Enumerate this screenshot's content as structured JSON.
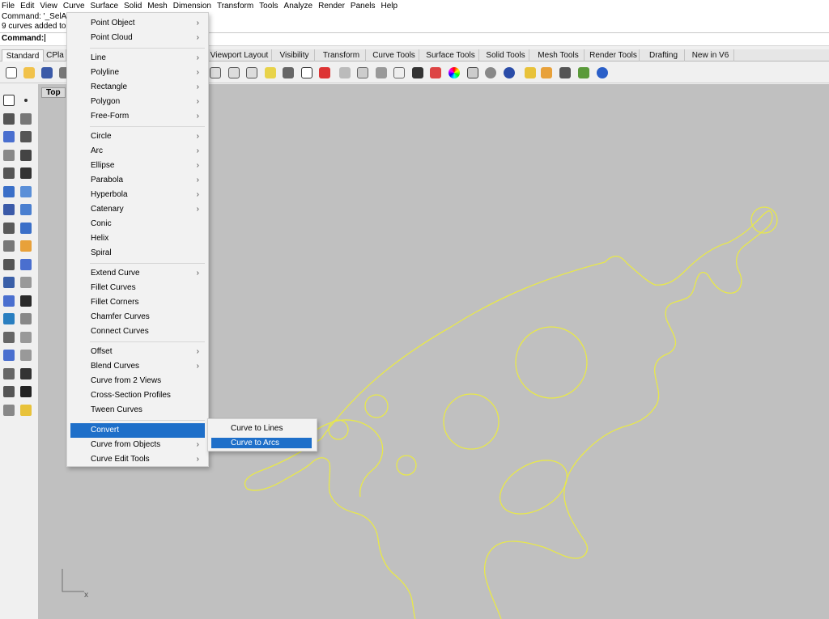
{
  "menubar": {
    "items": [
      "File",
      "Edit",
      "View",
      "Curve",
      "Surface",
      "Solid",
      "Mesh",
      "Dimension",
      "Transform",
      "Tools",
      "Analyze",
      "Render",
      "Panels",
      "Help"
    ]
  },
  "command": {
    "history": [
      "Command: '_SelAll",
      "9 curves added to"
    ],
    "prompt": "Command:"
  },
  "tabs": {
    "items": [
      "Standard",
      "CPla",
      "Viewport Layout",
      "Visibility",
      "Transform",
      "Curve Tools",
      "Surface Tools",
      "Solid Tools",
      "Mesh Tools",
      "Render Tools",
      "Drafting",
      "New in V6"
    ]
  },
  "viewport": {
    "name": "Top",
    "axis_label": "x",
    "curve_color": "#e8e84a"
  },
  "curve_menu": {
    "groups": [
      [
        {
          "label": "Point Object",
          "submenu": true
        },
        {
          "label": "Point Cloud",
          "submenu": true
        }
      ],
      [
        {
          "label": "Line",
          "submenu": true
        },
        {
          "label": "Polyline",
          "submenu": true
        },
        {
          "label": "Rectangle",
          "submenu": true
        },
        {
          "label": "Polygon",
          "submenu": true
        },
        {
          "label": "Free-Form",
          "submenu": true
        }
      ],
      [
        {
          "label": "Circle",
          "submenu": true
        },
        {
          "label": "Arc",
          "submenu": true
        },
        {
          "label": "Ellipse",
          "submenu": true
        },
        {
          "label": "Parabola",
          "submenu": true
        },
        {
          "label": "Hyperbola",
          "submenu": true
        },
        {
          "label": "Catenary",
          "submenu": true
        },
        {
          "label": "Conic",
          "submenu": false
        },
        {
          "label": "Helix",
          "submenu": false
        },
        {
          "label": "Spiral",
          "submenu": false
        }
      ],
      [
        {
          "label": "Extend Curve",
          "submenu": true
        },
        {
          "label": "Fillet Curves",
          "submenu": false
        },
        {
          "label": "Fillet Corners",
          "submenu": false
        },
        {
          "label": "Chamfer Curves",
          "submenu": false
        },
        {
          "label": "Connect Curves",
          "submenu": false
        }
      ],
      [
        {
          "label": "Offset",
          "submenu": true
        },
        {
          "label": "Blend Curves",
          "submenu": true
        },
        {
          "label": "Curve from 2 Views",
          "submenu": false
        },
        {
          "label": "Cross-Section Profiles",
          "submenu": false
        },
        {
          "label": "Tween Curves",
          "submenu": false
        }
      ],
      [
        {
          "label": "Convert",
          "submenu": false,
          "highlighted": true
        },
        {
          "label": "Curve from Objects",
          "submenu": true
        },
        {
          "label": "Curve Edit Tools",
          "submenu": true
        }
      ]
    ],
    "submenu_arrow": "›"
  },
  "convert_submenu": {
    "items": [
      {
        "label": "Curve to Lines",
        "highlighted": false
      },
      {
        "label": "Curve to Arcs",
        "highlighted": true
      }
    ]
  },
  "colors": {
    "highlight": "#1e6fc9",
    "viewport_bg": "#c0c0c0",
    "curve": "#e8e84a"
  }
}
